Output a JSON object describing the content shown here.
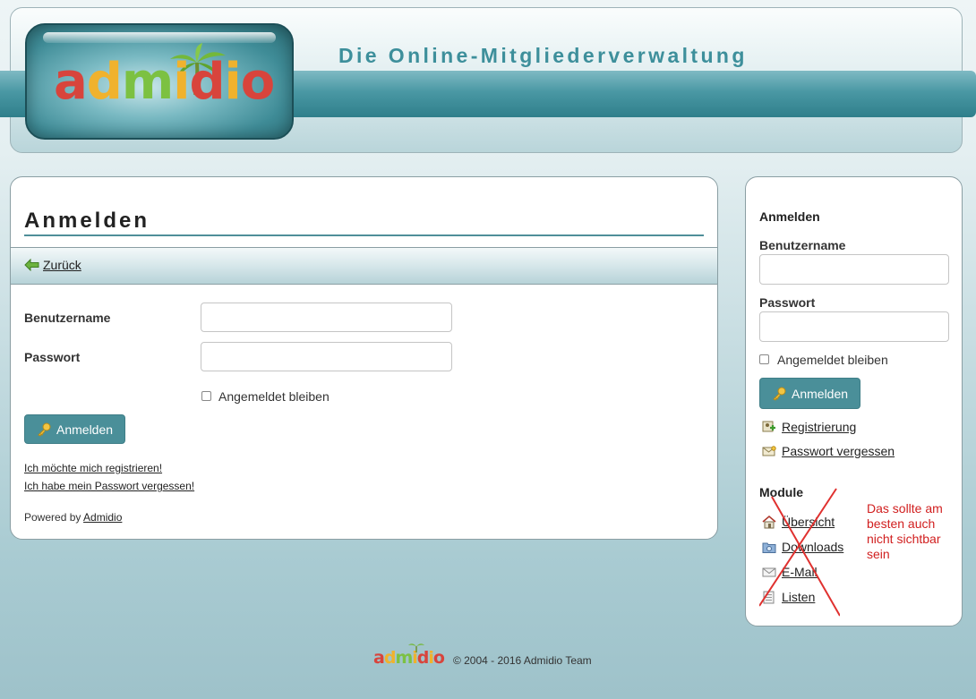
{
  "header": {
    "logo_text": "admidio",
    "title": "Die Online-Mitgliederverwaltung"
  },
  "main": {
    "title": "Anmelden",
    "back_link": "Zurück",
    "username_label": "Benutzername",
    "password_label": "Passwort",
    "remember_label": "Angemeldet bleiben",
    "login_button": "Anmelden",
    "register_link": "Ich möchte mich registrieren!",
    "forgot_link": "Ich habe mein Passwort vergessen!",
    "powered_by": "Powered by",
    "powered_link": "Admidio"
  },
  "sidebar": {
    "login_heading": "Anmelden",
    "username_label": "Benutzername",
    "password_label": "Passwort",
    "remember_label": "Angemeldet bleiben",
    "login_button": "Anmelden",
    "register_link": "Registrierung",
    "forgot_link": "Passwort vergessen",
    "modules_heading": "Module",
    "modules": [
      {
        "label": "Übersicht",
        "icon": "home-icon"
      },
      {
        "label": "Downloads",
        "icon": "folder-icon"
      },
      {
        "label": "E-Mail",
        "icon": "mail-icon"
      },
      {
        "label": "Listen",
        "icon": "list-icon"
      }
    ],
    "annotation": "Das sollte am besten auch nicht sichtbar sein",
    "annotation_color": "#d11f1f"
  },
  "footer": {
    "logo_text": "admidio",
    "copyright": "© 2004 - 2016  Admidio Team"
  },
  "colors": {
    "accent": "#4a8f99",
    "band": "#3f8d99",
    "title_teal": "#3d8f9b"
  }
}
